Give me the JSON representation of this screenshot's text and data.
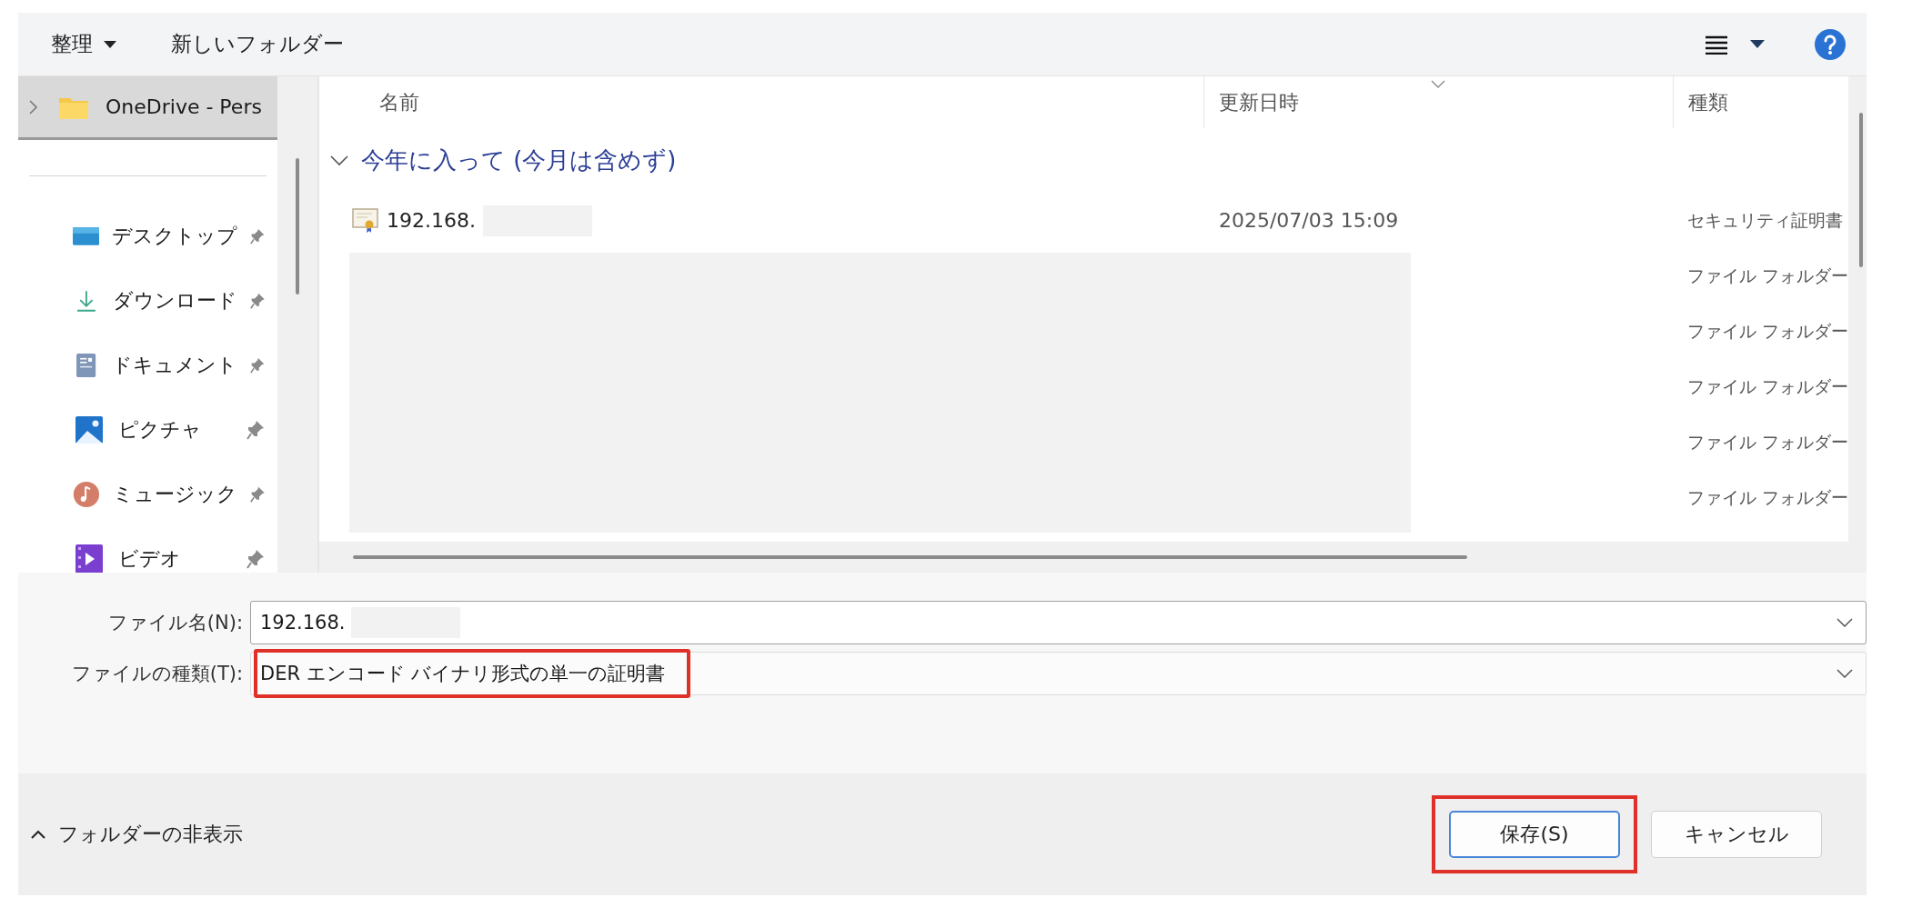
{
  "toolbar": {
    "organize": "整理",
    "new_folder": "新しいフォルダー"
  },
  "nav": {
    "items": [
      {
        "label": "OneDrive - Pers",
        "kind": "folder",
        "selected": true,
        "pinned": false
      },
      {
        "label": "デスクトップ",
        "kind": "desktop",
        "selected": false,
        "pinned": true
      },
      {
        "label": "ダウンロード",
        "kind": "download",
        "selected": false,
        "pinned": true
      },
      {
        "label": "ドキュメント",
        "kind": "document",
        "selected": false,
        "pinned": true
      },
      {
        "label": "ピクチャ",
        "kind": "picture",
        "selected": false,
        "pinned": true
      },
      {
        "label": "ミュージック",
        "kind": "music",
        "selected": false,
        "pinned": true
      },
      {
        "label": "ビデオ",
        "kind": "video",
        "selected": false,
        "pinned": true
      }
    ]
  },
  "columns": [
    {
      "label": "名前",
      "sorted": false
    },
    {
      "label": "更新日時",
      "sorted": true
    },
    {
      "label": "種類",
      "sorted": false
    }
  ],
  "group": {
    "label": "今年に入って (今月は含めず)",
    "expanded": true
  },
  "rows": [
    {
      "kind": "certificate",
      "name": "192.168.",
      "date": "2025/07/03 15:09",
      "type": "セキュリティ証明書"
    },
    {
      "kind": "redacted",
      "type": "ファイル フォルダー"
    },
    {
      "kind": "redacted",
      "type": "ファイル フォルダー"
    },
    {
      "kind": "redacted",
      "type": "ファイル フォルダー"
    },
    {
      "kind": "redacted",
      "type": "ファイル フォルダー"
    },
    {
      "kind": "redacted",
      "type": "ファイル フォルダー"
    }
  ],
  "file_name": {
    "label": "ファイル名(N):",
    "value": "192.168.",
    "redacted": true
  },
  "file_type": {
    "label": "ファイルの種類(T):",
    "value": "DER エンコード バイナリ形式の単一の証明書",
    "highlighted": true
  },
  "footer": {
    "toggle": "フォルダーの非表示",
    "buttons": [
      {
        "label": "保存(S)",
        "kind": "primary",
        "highlighted": true
      },
      {
        "label": "キャンセル",
        "kind": "secondary",
        "highlighted": false
      }
    ]
  }
}
